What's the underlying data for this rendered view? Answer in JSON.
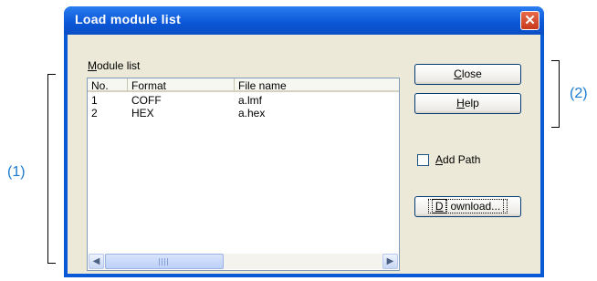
{
  "window": {
    "title": "Load module list"
  },
  "list": {
    "label_mnemonic": "M",
    "label_rest": "odule list",
    "columns": [
      "No.",
      "Format",
      "File name"
    ],
    "rows": [
      {
        "no": "1",
        "format": "COFF",
        "file": "a.lmf"
      },
      {
        "no": "2",
        "format": "HEX",
        "file": "a.hex"
      }
    ]
  },
  "buttons": {
    "close_mnemonic": "C",
    "close_rest": "lose",
    "help_mnemonic": "H",
    "help_rest": "elp",
    "download_mnemonic": "D",
    "download_rest": "ownload..."
  },
  "checkbox": {
    "mnemonic": "A",
    "rest": "dd Path"
  },
  "annotations": {
    "one": "(1)",
    "two": "(2)"
  }
}
